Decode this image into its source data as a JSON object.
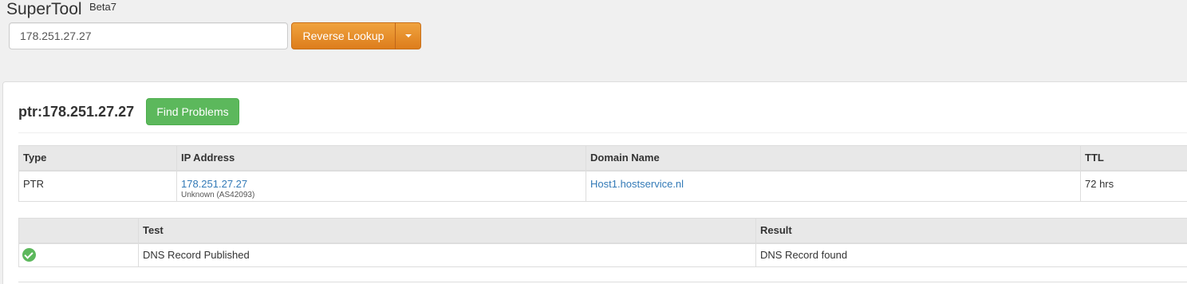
{
  "app": {
    "title": "SuperTool",
    "badge": "Beta7"
  },
  "search": {
    "value": "178.251.27.27",
    "button_label": "Reverse Lookup"
  },
  "result": {
    "title": "ptr:178.251.27.27",
    "find_problems_label": "Find Problems"
  },
  "records_table": {
    "headers": [
      "Type",
      "IP Address",
      "Domain Name",
      "TTL"
    ],
    "rows": [
      {
        "type": "PTR",
        "ip": "178.251.27.27",
        "ip_sub": "Unknown (AS42093)",
        "domain": "Host1.hostservice.nl",
        "ttl": "72 hrs"
      }
    ]
  },
  "tests_table": {
    "headers": [
      "",
      "Test",
      "Result"
    ],
    "rows": [
      {
        "status_icon": "check-circle-icon",
        "test": "DNS Record Published",
        "result": "DNS Record found"
      }
    ]
  },
  "colors": {
    "accent_orange": "#e8912e",
    "success_green": "#5cb85c",
    "link_blue": "#337ab7"
  }
}
